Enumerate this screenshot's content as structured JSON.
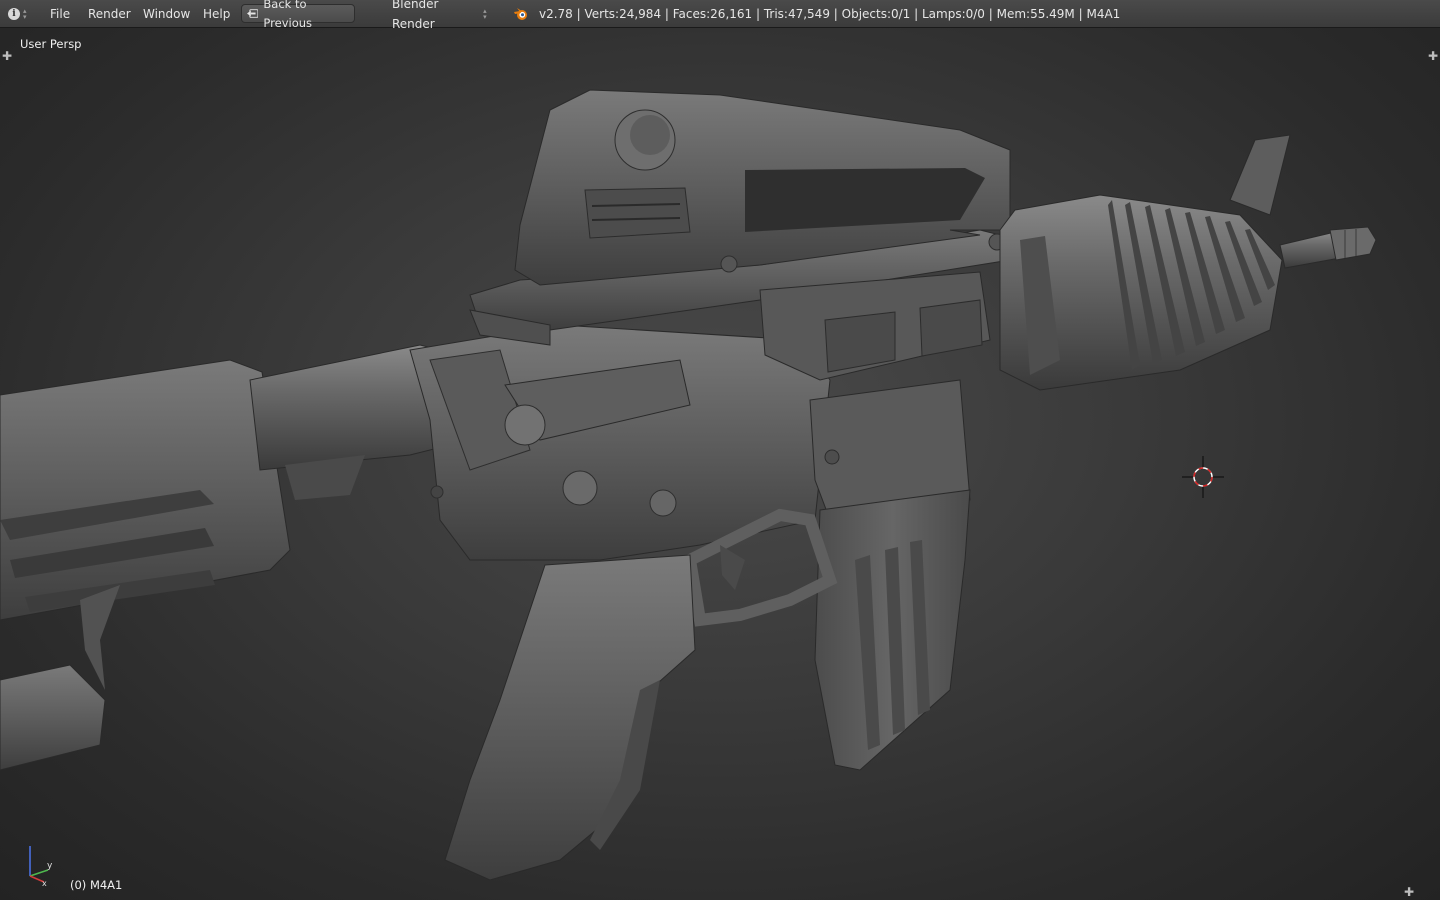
{
  "topbar": {
    "menu": {
      "file": "File",
      "render": "Render",
      "window": "Window",
      "help": "Help"
    },
    "back_button": "Back to Previous",
    "render_engine": "Blender Render",
    "stats": "v2.78 | Verts:24,984 | Faces:26,161 | Tris:47,549 | Objects:0/1 | Lamps:0/0 | Mem:55.49M | M4A1"
  },
  "viewport": {
    "view_label": "User Persp",
    "object_label": "(0) M4A1",
    "axis_labels": {
      "x": "x",
      "y": "y"
    }
  },
  "icons": {
    "editor_type": "info-icon",
    "back": "back-arrow-icon",
    "engine_logo": "blender-logo-icon",
    "cursor": "3d-cursor-icon",
    "axes": "axis-gizmo-icon"
  },
  "colors": {
    "header_bg": "#424242",
    "viewport_center": "#4a4a4a",
    "viewport_edge": "#232323",
    "model": "#5e5e5e",
    "axis_x": "#d23b3b",
    "axis_y": "#4fb84f",
    "axis_z": "#4a6fe0",
    "cursor_red": "#d32222"
  }
}
